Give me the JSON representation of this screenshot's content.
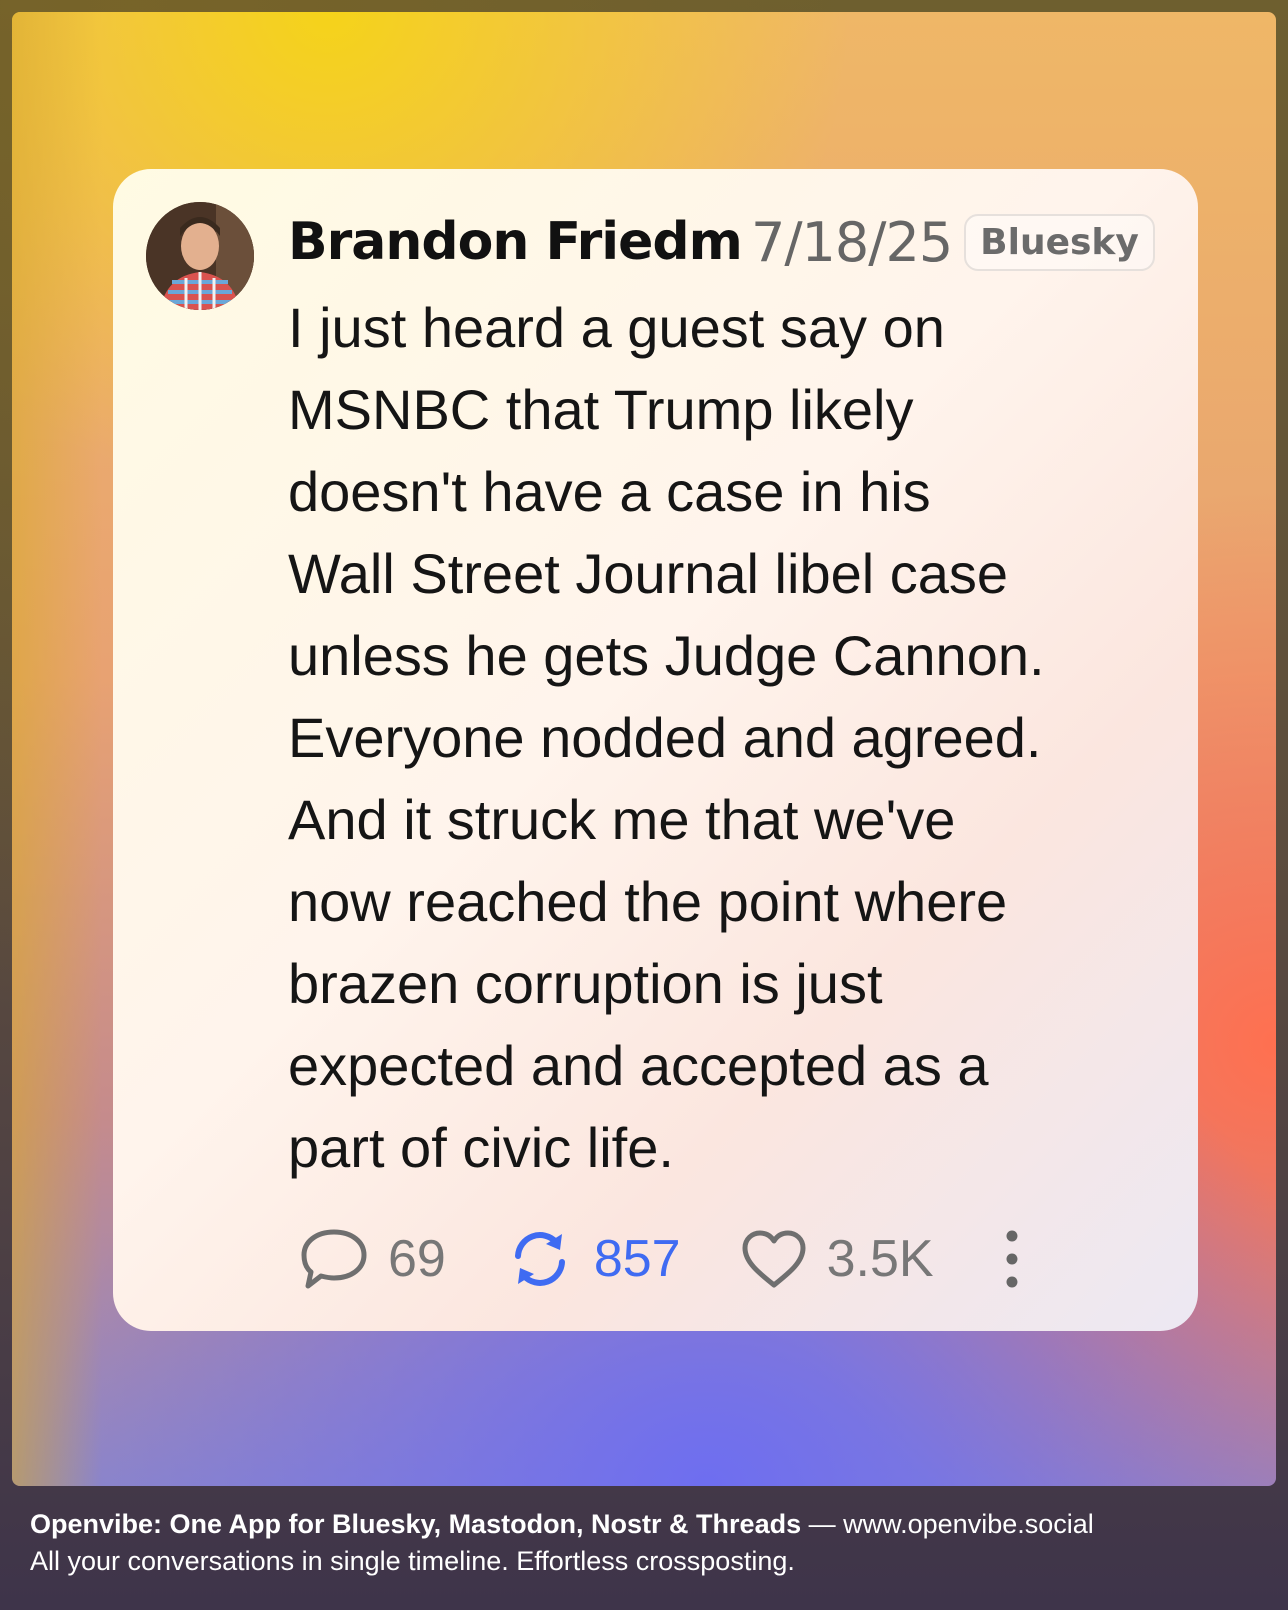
{
  "post": {
    "author": "Brandon Friedman",
    "date": "7/18/25",
    "platform": "Bluesky",
    "lines": [
      "I just heard a guest say on",
      "MSNBC that Trump likely",
      "doesn't have a case in his",
      "Wall Street Journal libel case",
      "unless he gets Judge Cannon.",
      "Everyone nodded and agreed.",
      "And it struck me that we've",
      "now reached the point where",
      "brazen corruption is just",
      "expected and accepted as a",
      "part of civic life."
    ],
    "stats": {
      "replies": "69",
      "reposts": "857",
      "likes": "3.5K"
    },
    "icons": [
      "avatar-photo",
      "reply-icon",
      "repost-icon",
      "heart-icon",
      "more-vertical-icon"
    ],
    "colors": {
      "repost_active": "#3f6bf2",
      "muted": "#777777"
    }
  },
  "footer": {
    "brand": "Openvibe: One App for Bluesky, Mastodon, Nostr & Threads",
    "separator": " — ",
    "url": "www.openvibe.social",
    "tagline": "All your conversations in single timeline. Effortless crossposting."
  }
}
